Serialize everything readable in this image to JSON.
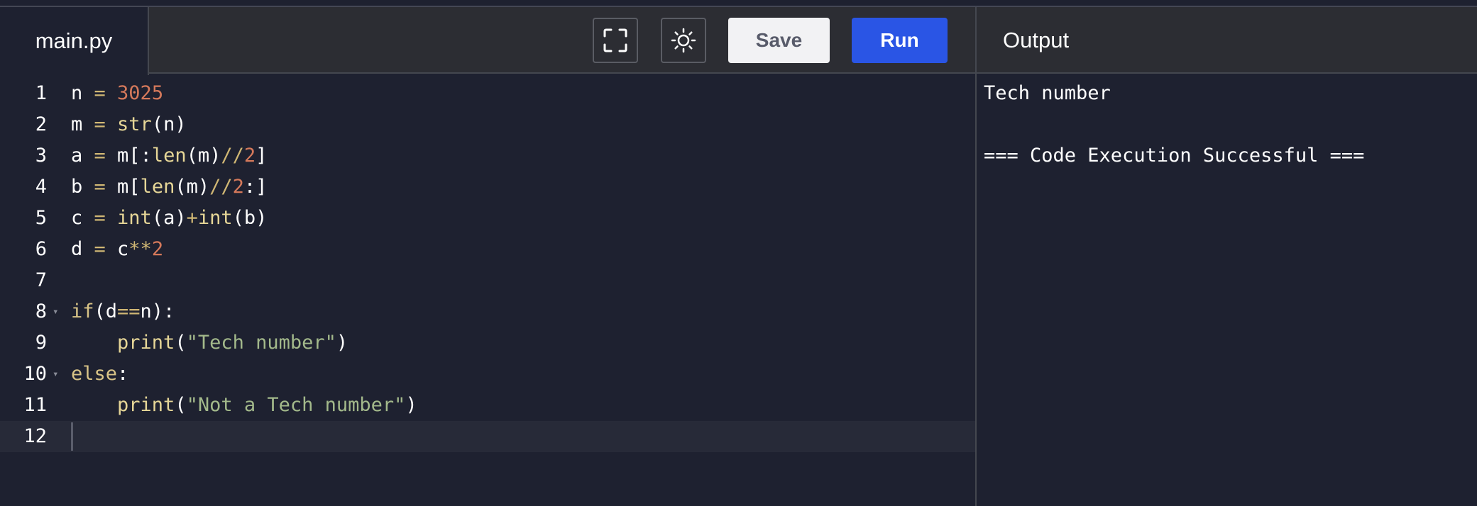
{
  "editor": {
    "file_tab": "main.py",
    "lines": [
      {
        "n": "1",
        "tokens": [
          [
            "plain",
            "n "
          ],
          [
            "op",
            "="
          ],
          [
            "plain",
            " "
          ],
          [
            "num",
            "3025"
          ]
        ]
      },
      {
        "n": "2",
        "tokens": [
          [
            "plain",
            "m "
          ],
          [
            "op",
            "="
          ],
          [
            "plain",
            " "
          ],
          [
            "fn",
            "str"
          ],
          [
            "plain",
            "(n)"
          ]
        ]
      },
      {
        "n": "3",
        "tokens": [
          [
            "plain",
            "a "
          ],
          [
            "op",
            "="
          ],
          [
            "plain",
            " m[:"
          ],
          [
            "fn",
            "len"
          ],
          [
            "plain",
            "(m)"
          ],
          [
            "op",
            "//"
          ],
          [
            "num",
            "2"
          ],
          [
            "plain",
            "]"
          ]
        ]
      },
      {
        "n": "4",
        "tokens": [
          [
            "plain",
            "b "
          ],
          [
            "op",
            "="
          ],
          [
            "plain",
            " m["
          ],
          [
            "fn",
            "len"
          ],
          [
            "plain",
            "(m)"
          ],
          [
            "op",
            "//"
          ],
          [
            "num",
            "2"
          ],
          [
            "plain",
            ":]"
          ]
        ]
      },
      {
        "n": "5",
        "tokens": [
          [
            "plain",
            "c "
          ],
          [
            "op",
            "="
          ],
          [
            "plain",
            " "
          ],
          [
            "fn",
            "int"
          ],
          [
            "plain",
            "(a)"
          ],
          [
            "op",
            "+"
          ],
          [
            "fn",
            "int"
          ],
          [
            "plain",
            "(b)"
          ]
        ]
      },
      {
        "n": "6",
        "tokens": [
          [
            "plain",
            "d "
          ],
          [
            "op",
            "="
          ],
          [
            "plain",
            " c"
          ],
          [
            "op",
            "**"
          ],
          [
            "num",
            "2"
          ]
        ]
      },
      {
        "n": "7",
        "tokens": []
      },
      {
        "n": "8",
        "fold": true,
        "tokens": [
          [
            "kw",
            "if"
          ],
          [
            "plain",
            "(d"
          ],
          [
            "op",
            "=="
          ],
          [
            "plain",
            "n):"
          ]
        ]
      },
      {
        "n": "9",
        "tokens": [
          [
            "plain",
            "    "
          ],
          [
            "fn",
            "print"
          ],
          [
            "plain",
            "("
          ],
          [
            "str",
            "\"Tech number\""
          ],
          [
            "plain",
            ")"
          ]
        ]
      },
      {
        "n": "10",
        "fold": true,
        "tokens": [
          [
            "kw",
            "else"
          ],
          [
            "plain",
            ":"
          ]
        ]
      },
      {
        "n": "11",
        "tokens": [
          [
            "plain",
            "    "
          ],
          [
            "fn",
            "print"
          ],
          [
            "plain",
            "("
          ],
          [
            "str",
            "\"Not a Tech number\""
          ],
          [
            "plain",
            ")"
          ]
        ]
      },
      {
        "n": "12",
        "active": true,
        "tokens": []
      }
    ]
  },
  "toolbar": {
    "fullscreen_icon": "fullscreen-icon",
    "theme_icon": "sun-icon",
    "save_label": "Save",
    "run_label": "Run"
  },
  "output": {
    "title": "Output",
    "lines": [
      "Tech number",
      "",
      "=== Code Execution Successful ==="
    ]
  },
  "colors": {
    "background": "#1e2130",
    "header": "#2c2d33",
    "run_button": "#2a55e5",
    "save_button": "#f2f2f4"
  }
}
